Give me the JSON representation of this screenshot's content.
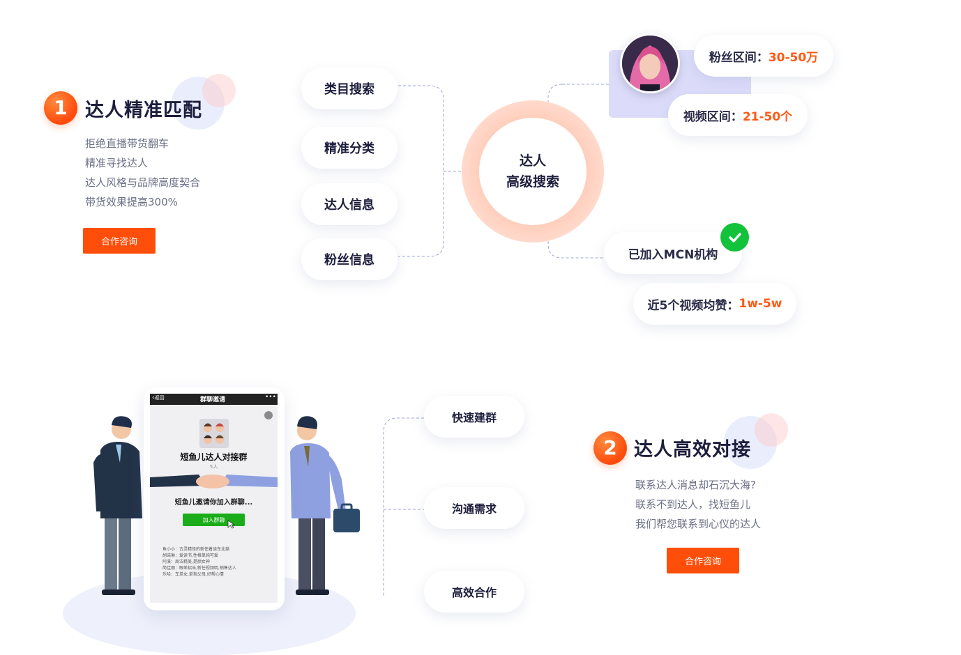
{
  "section1": {
    "number": "1",
    "title": "达人精准匹配",
    "lines": [
      "拒绝直播带货翻车",
      "精准寻找达人",
      "达人风格与品牌高度契合",
      "带货效果提高300%"
    ],
    "cta": "合作咨询"
  },
  "search_pills": [
    "类目搜索",
    "精准分类",
    "达人信息",
    "粉丝信息"
  ],
  "center": {
    "line1": "达人",
    "line2": "高级搜索"
  },
  "info": {
    "fans": {
      "label": "粉丝区间：",
      "value": "30-50万"
    },
    "videos": {
      "label": "视频区间：",
      "value": "21-50个"
    },
    "mcn": {
      "label": "已加入MCN机构"
    },
    "likes": {
      "label": "近5个视频均赞：",
      "value": "1w-5w"
    }
  },
  "phone": {
    "back": "返回",
    "title": "群聊邀请",
    "menu": "•••",
    "group_name": "短鱼儿达人对接群",
    "member_count": "5人",
    "invite_text": "短鱼儿邀请你加入群聊...",
    "join_button": "加入群聊",
    "members": [
      "鱼小小：古灵精怪的新任着读东北菇",
      "胡诺琳：爱读书,性格单纯可爱",
      "阿溪：周洁精美,是颜女神",
      "简佳丽：眼差招当,新任视频明,销售达人",
      "乐哈：车单女,单指父母,好帮心情"
    ]
  },
  "flow_pills": [
    "快速建群",
    "沟通需求",
    "高效合作"
  ],
  "section2": {
    "number": "2",
    "title": "达人高效对接",
    "lines": [
      "联系达人消息却石沉大海?",
      "联系不到达人，找短鱼儿",
      "我们帮您联系到心仪的达人"
    ],
    "cta": "合作咨询"
  },
  "colors": {
    "accent": "#ff4e0a",
    "value_orange": "#ff5a16",
    "check_green": "#12c23a",
    "dash_line": "#9da3d6"
  }
}
